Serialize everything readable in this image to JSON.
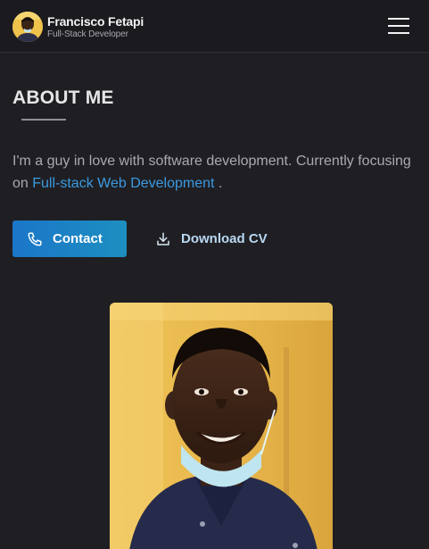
{
  "header": {
    "name": "Francisco Fetapi",
    "role": "Full-Stack Developer",
    "avatar_icon": "avatar-portrait",
    "menu_icon": "hamburger-menu-icon"
  },
  "about": {
    "title": "ABOUT ME",
    "bio_text": "I'm a guy in love with software development. Currently focusing",
    "bio_prefix": "on",
    "bio_link": "Full-stack Web Development",
    "bio_suffix": " ."
  },
  "actions": {
    "contact_label": "Contact",
    "contact_icon": "phone-icon",
    "download_label": "Download CV",
    "download_icon": "download-icon"
  },
  "colors": {
    "background": "#1f1f23",
    "accent": "#1b76c8",
    "link": "#3b9ae1"
  }
}
